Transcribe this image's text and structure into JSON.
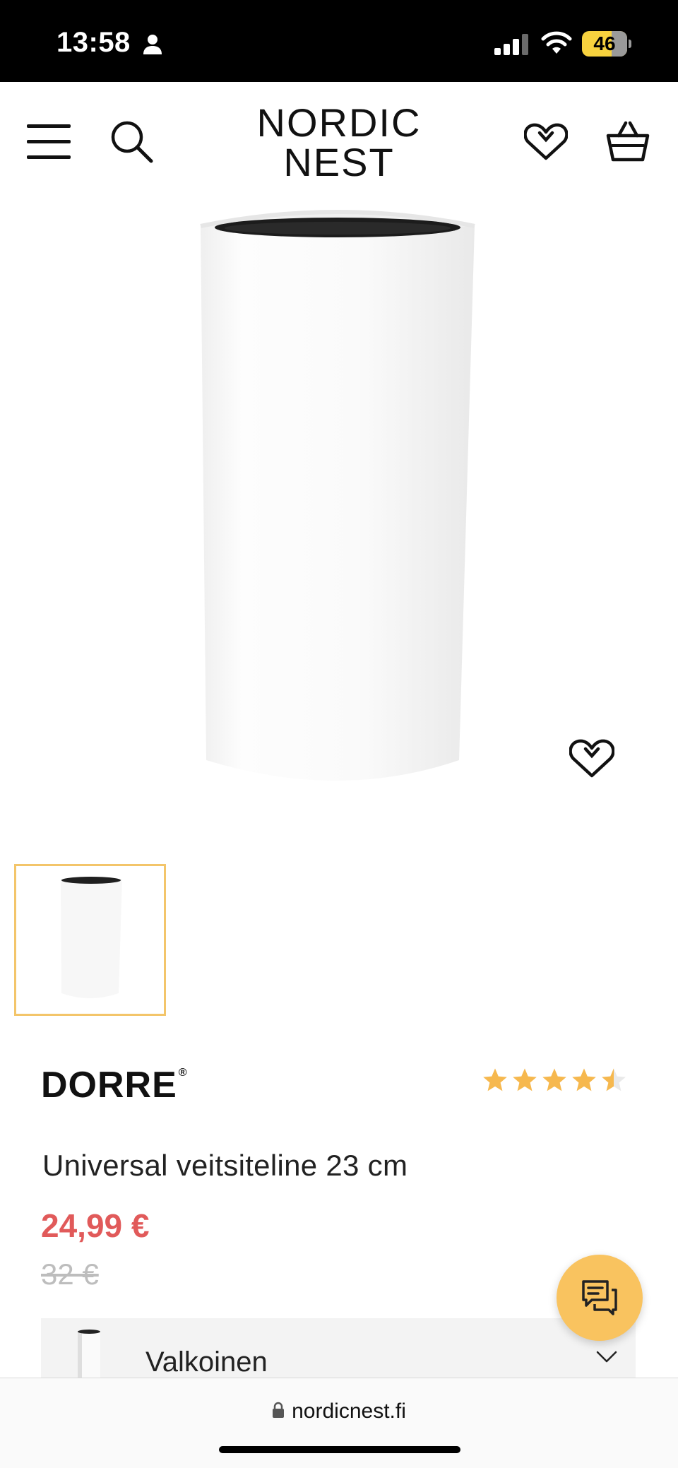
{
  "status_bar": {
    "time": "13:58",
    "battery": "46"
  },
  "header": {
    "logo_line1": "NORDIC",
    "logo_line2": "NEST"
  },
  "product": {
    "brand": "DORRE",
    "brand_mark": "®",
    "rating": 4.5,
    "title": "Universal veitsiteline 23 cm",
    "price_current": "24,99 €",
    "price_old": "32 €"
  },
  "variant": {
    "selected": "Valkoinen"
  },
  "browser": {
    "url": "nordicnest.fi"
  },
  "colors": {
    "accent": "#f9c35f",
    "star": "#f6b84e",
    "price": "#e15a5a",
    "old_price": "#bdbdbd",
    "thumb_border": "#f3c56a"
  },
  "icons": [
    "menu-icon",
    "search-icon",
    "wishlist-icon",
    "cart-icon",
    "heart-icon",
    "chat-icon",
    "chevron-down-icon",
    "lock-icon",
    "person-icon",
    "signal-icon",
    "wifi-icon"
  ]
}
